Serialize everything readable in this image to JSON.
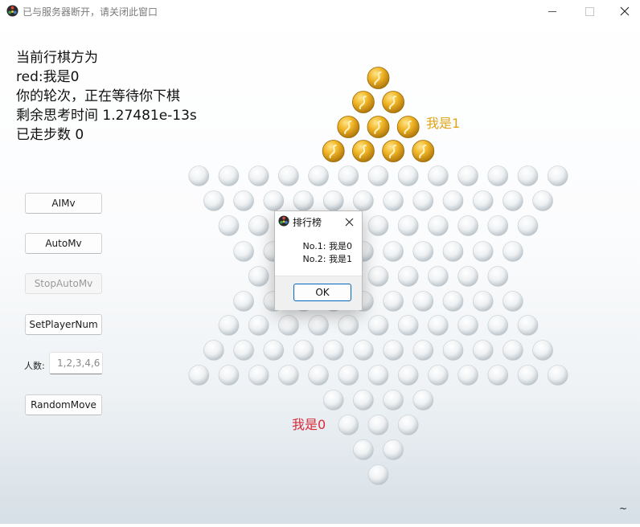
{
  "window": {
    "title": "已与服务器断开，请关闭此窗口",
    "minimize_icon": "minimize-icon",
    "maximize_icon": "maximize-icon",
    "close_icon": "close-icon"
  },
  "status": {
    "line1": "当前行棋方为",
    "line2": "red:我是0",
    "line3": "你的轮次，正在等待你下棋",
    "line4": "剩余思考时间 1.27481e-13s",
    "line5": "已走步数 0"
  },
  "controls": {
    "aimv": "AIMv",
    "automv": "AutoMv",
    "stopautomv": "StopAutoMv",
    "setplayernum": "SetPlayerNum",
    "players_label": "人数:",
    "players_placeholder": "1,2,3,4,6",
    "randommove": "RandomMove"
  },
  "board": {
    "player1_label": "我是1",
    "player0_label": "我是0",
    "player1_color": "#e0a418",
    "player0_color": "#d62c3a",
    "player1_piece_count": 10,
    "empty_hole_color": "#e9ecee"
  },
  "dialog": {
    "title": "排行榜",
    "rank1": "No.1: 我是0",
    "rank2": "No.2: 我是1",
    "ok": "OK",
    "close_icon": "close-icon"
  },
  "footer": {
    "tilde": "~"
  }
}
